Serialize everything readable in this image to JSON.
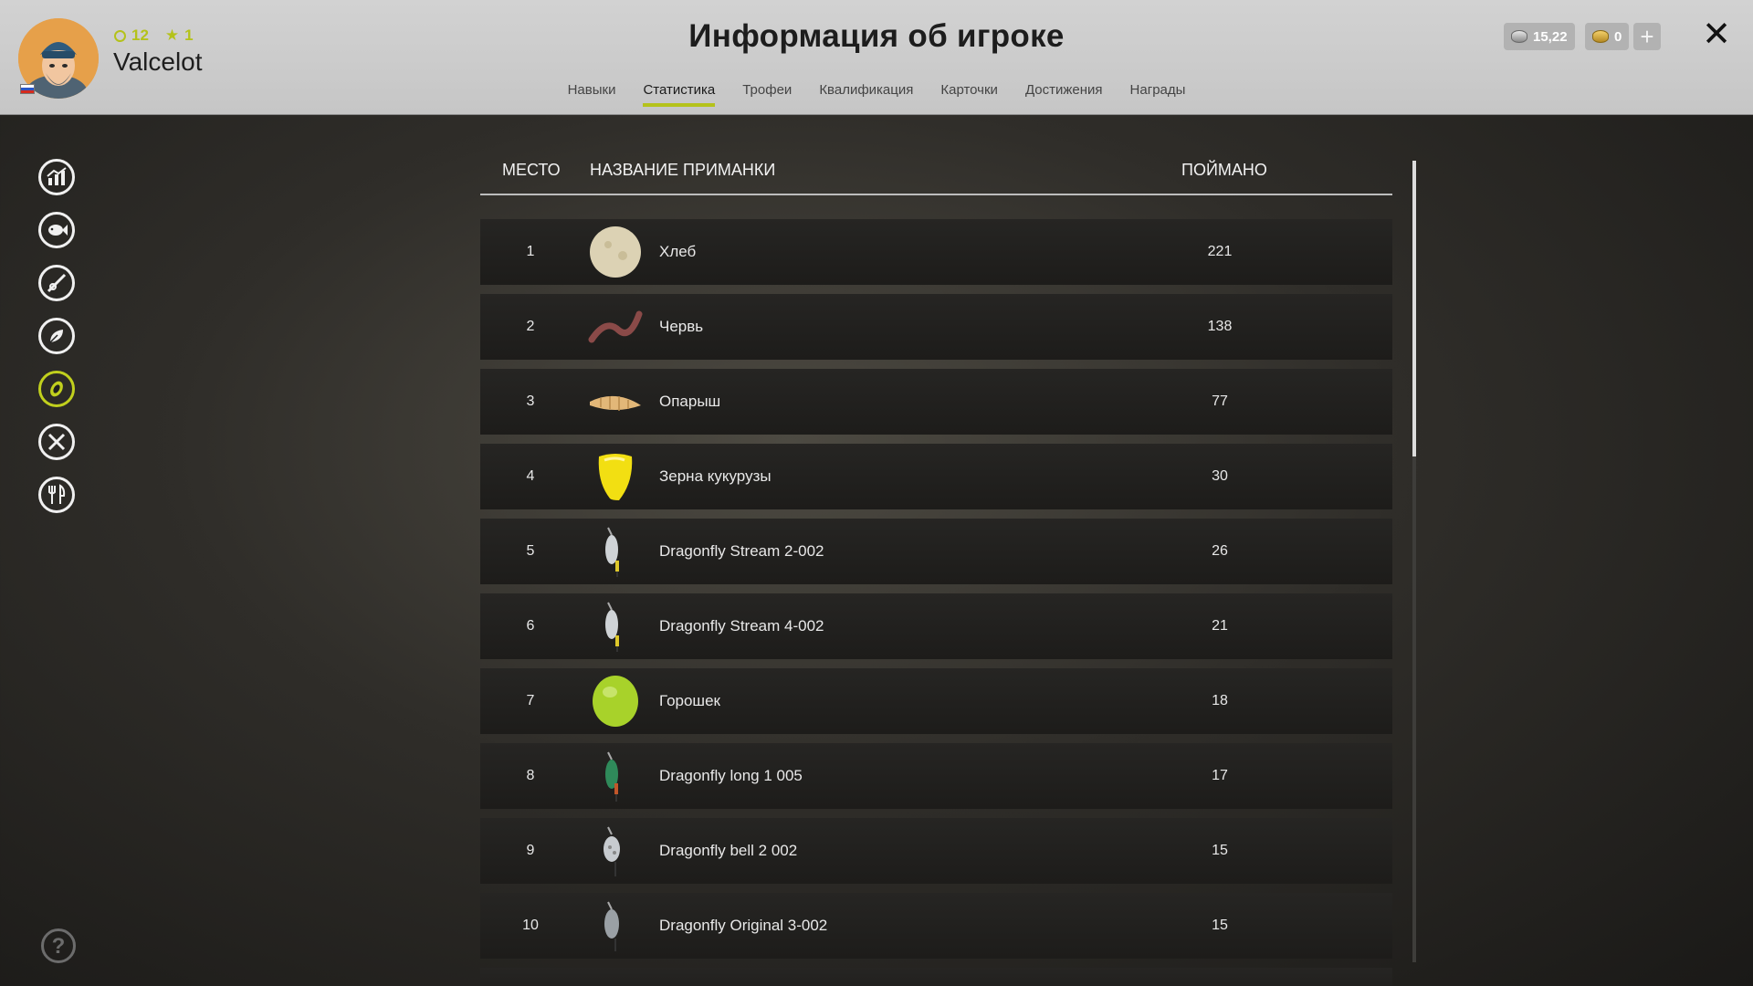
{
  "header": {
    "title": "Информация об игроке",
    "player": {
      "name": "Valcelot",
      "level": "12",
      "rank": "1"
    },
    "currency": {
      "silver": "15,22",
      "gold": "0"
    },
    "plus_label": "+",
    "close_label": "✕"
  },
  "tabs": [
    {
      "label": "Навыки"
    },
    {
      "label": "Статистика"
    },
    {
      "label": "Трофеи"
    },
    {
      "label": "Квалификация"
    },
    {
      "label": "Карточки"
    },
    {
      "label": "Достижения"
    },
    {
      "label": "Награды"
    }
  ],
  "active_tab": "Статистика",
  "sidebar": [
    {
      "icon": "chart-icon"
    },
    {
      "icon": "fish-icon"
    },
    {
      "icon": "rod-icon"
    },
    {
      "icon": "bait-icon"
    },
    {
      "icon": "lure-icon",
      "active": true
    },
    {
      "icon": "tools-icon"
    },
    {
      "icon": "food-icon"
    }
  ],
  "help_label": "?",
  "table": {
    "columns": {
      "place": "МЕСТО",
      "name": "НАЗВАНИЕ ПРИМАНКИ",
      "caught": "ПОЙМАНО"
    },
    "rows": [
      {
        "place": "1",
        "name": "Хлеб",
        "caught": "221",
        "icon": "bread-icon"
      },
      {
        "place": "2",
        "name": "Червь",
        "caught": "138",
        "icon": "worm-icon"
      },
      {
        "place": "3",
        "name": "Опарыш",
        "caught": "77",
        "icon": "maggot-icon"
      },
      {
        "place": "4",
        "name": "Зерна кукурузы",
        "caught": "30",
        "icon": "corn-icon"
      },
      {
        "place": "5",
        "name": "Dragonfly Stream 2-002",
        "caught": "26",
        "icon": "spinner-icon"
      },
      {
        "place": "6",
        "name": "Dragonfly Stream 4-002",
        "caught": "21",
        "icon": "spinner-icon"
      },
      {
        "place": "7",
        "name": "Горошек",
        "caught": "18",
        "icon": "pea-icon"
      },
      {
        "place": "8",
        "name": "Dragonfly long 1 005",
        "caught": "17",
        "icon": "spinner-green-icon"
      },
      {
        "place": "9",
        "name": "Dragonfly bell 2 002",
        "caught": "15",
        "icon": "spinner-icon"
      },
      {
        "place": "10",
        "name": "Dragonfly Original 3-002",
        "caught": "15",
        "icon": "spinner-icon"
      }
    ]
  },
  "colors": {
    "accent": "#b4c21b",
    "header_bg": "#c8c8c8",
    "row_bg": "#232220"
  }
}
